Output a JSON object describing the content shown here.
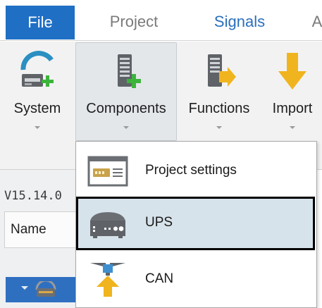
{
  "tabs": {
    "file": "File",
    "project": "Project",
    "signals": "Signals",
    "partial": "A"
  },
  "ribbon": {
    "system": "System",
    "components": "Components",
    "functions": "Functions",
    "import": "Import"
  },
  "panel": {
    "version": "V15.14.0",
    "name_header": "Name"
  },
  "menu": {
    "items": [
      {
        "label": "Project settings",
        "icon": "project-settings-icon"
      },
      {
        "label": "UPS",
        "icon": "ups-device-icon",
        "selected": true
      },
      {
        "label": "CAN",
        "icon": "can-bus-icon"
      }
    ]
  },
  "colors": {
    "file_tab": "#1f6fc5",
    "signals_tab_text": "#2a6fbe",
    "selected_item_bg": "#d7e3ea",
    "green_plus": "#3cb43c",
    "import_arrow": "#f0b41e"
  }
}
